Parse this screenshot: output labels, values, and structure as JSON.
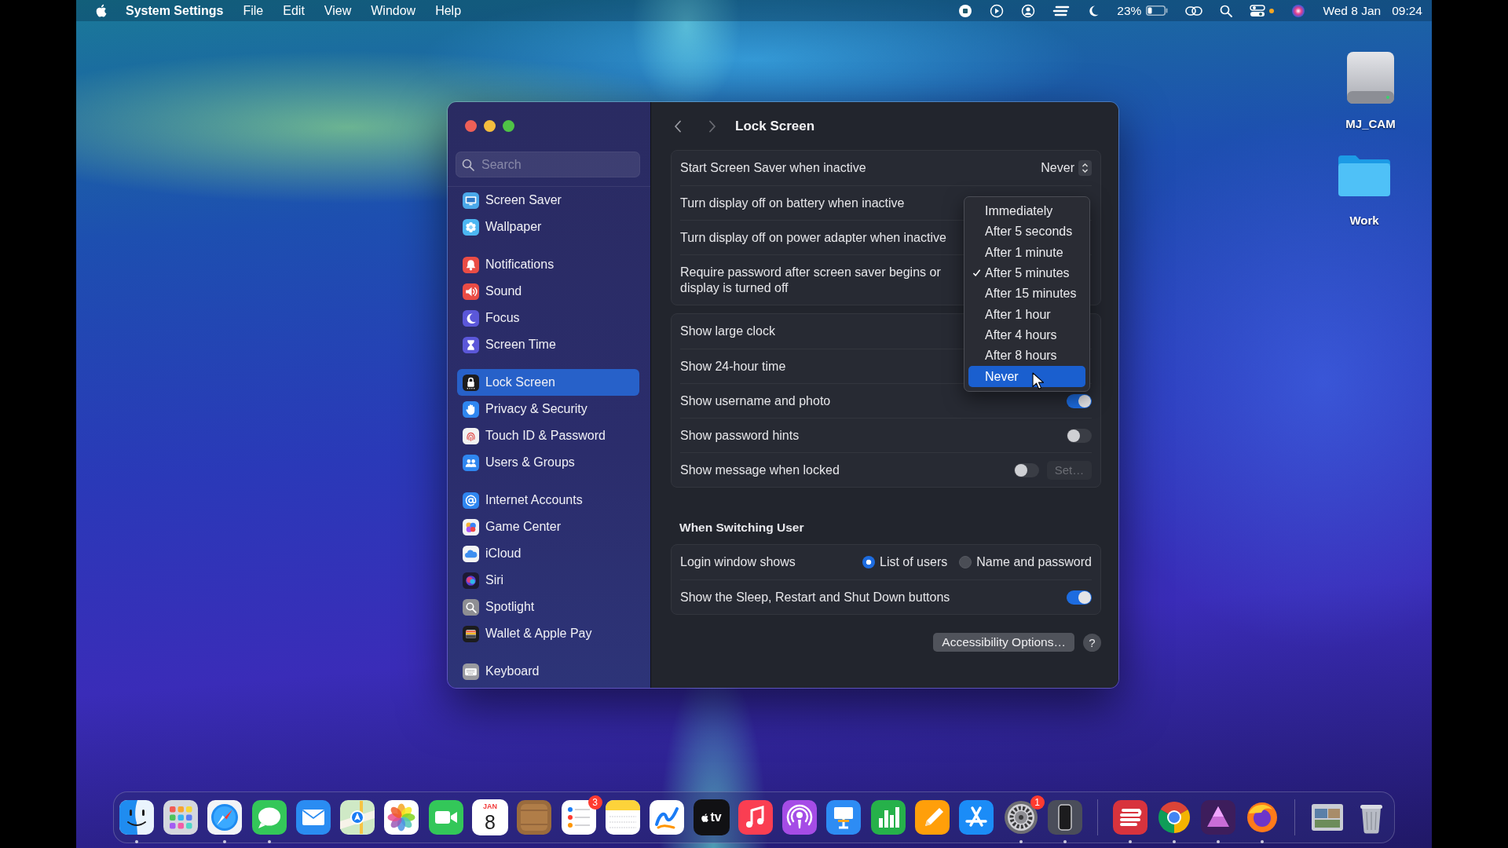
{
  "menu_bar": {
    "app_name": "System Settings",
    "menus": [
      "File",
      "Edit",
      "View",
      "Window",
      "Help"
    ],
    "battery_percent": "23%",
    "date": "Wed 8 Jan",
    "time": "09:24"
  },
  "desktop": {
    "icons": [
      {
        "kind": "volume",
        "label": "MJ_CAM"
      },
      {
        "kind": "folder",
        "label": "Work"
      }
    ]
  },
  "window": {
    "sidebar": {
      "search": {
        "placeholder": "Search"
      },
      "groups": [
        {
          "items": [
            {
              "label": "Screen Saver",
              "color": "#4aa8ea",
              "selected": false
            },
            {
              "label": "Wallpaper",
              "color": "#4cb6f2",
              "selected": false
            }
          ]
        },
        {
          "items": [
            {
              "label": "Notifications",
              "color": "#ea4c45",
              "selected": false
            },
            {
              "label": "Sound",
              "color": "#ea4c45",
              "selected": false
            },
            {
              "label": "Focus",
              "color": "#5b57d9",
              "selected": false
            },
            {
              "label": "Screen Time",
              "color": "#5b57d9",
              "selected": false
            }
          ]
        },
        {
          "items": [
            {
              "label": "Lock Screen",
              "color": "#1c1c1e",
              "selected": true
            },
            {
              "label": "Privacy & Security",
              "color": "#2f86f0",
              "selected": false
            },
            {
              "label": "Touch ID & Password",
              "color": "#f2f2f2",
              "selected": false
            },
            {
              "label": "Users & Groups",
              "color": "#2f86f0",
              "selected": false
            }
          ]
        },
        {
          "items": [
            {
              "label": "Internet Accounts",
              "color": "#2f86f0",
              "selected": false
            },
            {
              "label": "Game Center",
              "color": "#f4f4f4",
              "selected": false
            },
            {
              "label": "iCloud",
              "color": "#f4f4f4",
              "selected": false
            },
            {
              "label": "Siri",
              "color": "#1d1a33",
              "selected": false
            },
            {
              "label": "Spotlight",
              "color": "#8e8e93",
              "selected": false
            },
            {
              "label": "Wallet & Apple Pay",
              "color": "#1c1c1e",
              "selected": false
            }
          ]
        },
        {
          "items": [
            {
              "label": "Keyboard",
              "color": "#9a9aa0",
              "selected": false
            }
          ]
        }
      ]
    },
    "content": {
      "title": "Lock Screen",
      "sections": [
        {
          "rows": [
            {
              "kind": "popup",
              "label": "Start Screen Saver when inactive",
              "value": "Never"
            },
            {
              "kind": "text",
              "label": "Turn display off on battery when inactive"
            },
            {
              "kind": "text",
              "label": "Turn display off on power adapter when inactive"
            },
            {
              "kind": "text",
              "label": "Require password after screen saver begins or display is turned off"
            }
          ]
        },
        {
          "rows": [
            {
              "kind": "text",
              "label": "Show large clock"
            },
            {
              "kind": "text",
              "label": "Show 24-hour time"
            },
            {
              "kind": "toggle",
              "label": "Show username and photo",
              "on": true
            },
            {
              "kind": "toggle",
              "label": "Show password hints",
              "on": false
            },
            {
              "kind": "toggle",
              "label": "Show message when locked",
              "on": false,
              "button": {
                "label": "Set…",
                "disabled": true
              }
            }
          ]
        },
        {
          "heading": "When Switching User",
          "rows": [
            {
              "kind": "radio",
              "label": "Login window shows",
              "options": [
                {
                  "label": "List of users",
                  "selected": true
                },
                {
                  "label": "Name and password",
                  "selected": false
                }
              ]
            },
            {
              "kind": "toggle",
              "label": "Show the Sleep, Restart and Shut Down buttons",
              "on": true
            }
          ]
        }
      ],
      "popup_menu": {
        "items": [
          {
            "label": "Immediately",
            "checked": false,
            "highlighted": false
          },
          {
            "label": "After 5 seconds",
            "checked": false,
            "highlighted": false
          },
          {
            "label": "After 1 minute",
            "checked": false,
            "highlighted": false
          },
          {
            "label": "After 5 minutes",
            "checked": true,
            "highlighted": false
          },
          {
            "label": "After 15 minutes",
            "checked": false,
            "highlighted": false
          },
          {
            "label": "After 1 hour",
            "checked": false,
            "highlighted": false
          },
          {
            "label": "After 4 hours",
            "checked": false,
            "highlighted": false
          },
          {
            "label": "After 8 hours",
            "checked": false,
            "highlighted": false
          },
          {
            "label": "Never",
            "checked": false,
            "highlighted": true
          }
        ]
      },
      "footer": {
        "button": "Accessibility Options…",
        "help": "?"
      }
    }
  },
  "dock": {
    "sections": [
      {
        "items": [
          {
            "running": true
          },
          {
            "running": false
          },
          {
            "running": true
          },
          {
            "running": true
          },
          {
            "running": false
          },
          {
            "running": false
          },
          {
            "running": false
          },
          {
            "running": false
          },
          {
            "running": false,
            "month": "JAN",
            "day": "8"
          },
          {
            "running": false
          },
          {
            "running": false,
            "badge": "3"
          },
          {
            "running": false
          },
          {
            "running": false
          },
          {
            "running": false,
            "label": "tv"
          },
          {
            "running": false
          },
          {
            "running": false
          },
          {
            "running": false
          },
          {
            "running": false
          },
          {
            "running": false
          },
          {
            "running": false
          },
          {
            "running": true,
            "badge": "1"
          },
          {
            "running": true
          }
        ]
      },
      {
        "items": [
          {
            "running": true
          },
          {
            "running": true
          },
          {
            "running": true
          },
          {
            "running": true
          }
        ]
      },
      {
        "items": [
          {
            "running": false
          },
          {
            "running": false
          }
        ]
      }
    ]
  }
}
